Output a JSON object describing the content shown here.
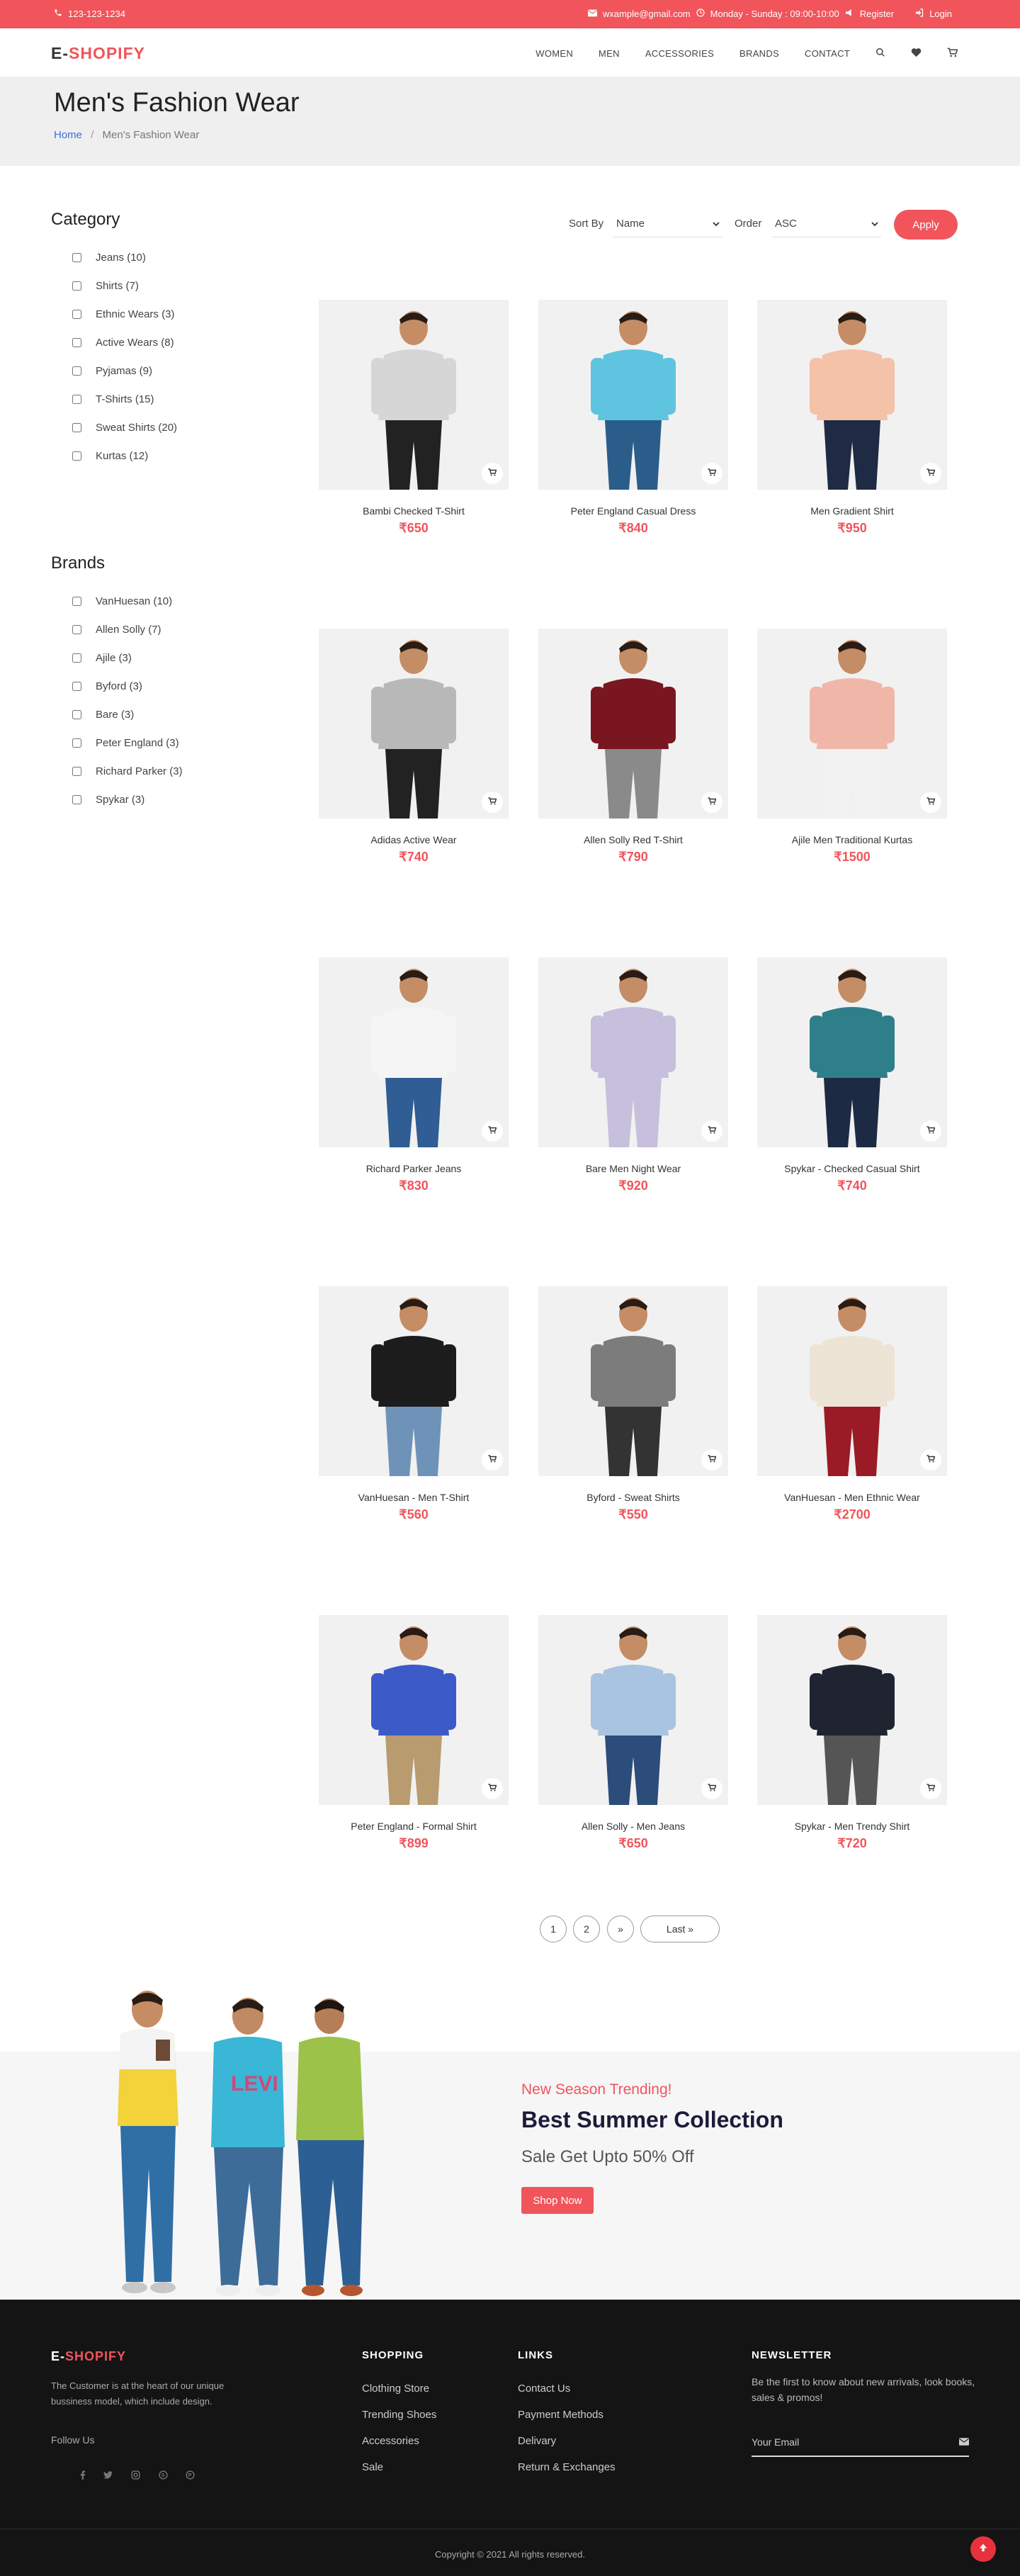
{
  "topbar": {
    "phone": "123-123-1234",
    "email": "wxample@gmail.com",
    "hours": "Monday - Sunday : 09:00-10:00",
    "register": "Register",
    "login": "Login",
    "bg_color": "#f1545b"
  },
  "header": {
    "logo_prefix": "E-",
    "logo_main": "SHOPIFY",
    "nav": [
      "WOMEN",
      "MEN",
      "ACCESSORIES",
      "BRANDS",
      "CONTACT"
    ],
    "icons": [
      "search-icon",
      "heart-icon",
      "cart-icon"
    ]
  },
  "page": {
    "title": "Men's Fashion Wear",
    "breadcrumb_home": "Home",
    "breadcrumb_sep": "/",
    "breadcrumb_current": "Men's Fashion Wear"
  },
  "sidebar": {
    "category_title": "Category",
    "categories": [
      "Jeans (10)",
      "Shirts (7)",
      "Ethnic Wears (3)",
      "Active Wears (8)",
      "Pyjamas (9)",
      "T-Shirts (15)",
      "Sweat Shirts (20)",
      "Kurtas (12)"
    ],
    "brands_title": "Brands",
    "brands": [
      "VanHuesan (10)",
      "Allen Solly (7)",
      "Ajile (3)",
      "Byford (3)",
      "Bare (3)",
      "Peter England (3)",
      "Richard Parker (3)",
      "Spykar (3)"
    ]
  },
  "sort": {
    "sort_label": "Sort By",
    "sort_value": "Name",
    "order_label": "Order",
    "order_value": "ASC",
    "apply": "Apply"
  },
  "products": [
    {
      "name": "Bambi Checked T-Shirt",
      "price": "₹650",
      "shirt": "#d6d6d6",
      "pants": "#222"
    },
    {
      "name": "Peter England Casual Dress",
      "price": "₹840",
      "shirt": "#5fc4e0",
      "pants": "#2b5d8a"
    },
    {
      "name": "Men Gradient Shirt",
      "price": "₹950",
      "shirt": "#f3c2a8",
      "pants": "#1f2a44"
    },
    {
      "name": "Adidas Active Wear",
      "price": "₹740",
      "shirt": "#b8b8b8",
      "pants": "#222"
    },
    {
      "name": "Allen Solly Red T-Shirt",
      "price": "₹790",
      "shirt": "#7a1620",
      "pants": "#8a8a8a"
    },
    {
      "name": "Ajile Men Traditional Kurtas",
      "price": "₹1500",
      "shirt": "#f0b7a8",
      "pants": "#f2f2f2"
    },
    {
      "name": "Richard Parker Jeans",
      "price": "₹830",
      "shirt": "#f5f5f5",
      "pants": "#2f5d94"
    },
    {
      "name": "Bare Men Night Wear",
      "price": "₹920",
      "shirt": "#c6c0dc",
      "pants": "#c6c0dc"
    },
    {
      "name": "Spykar - Checked Casual Shirt",
      "price": "₹740",
      "shirt": "#2f7f8a",
      "pants": "#1d2a44"
    },
    {
      "name": "VanHuesan - Men T-Shirt",
      "price": "₹560",
      "shirt": "#1c1c1c",
      "pants": "#6f93b8"
    },
    {
      "name": "Byford - Sweat Shirts",
      "price": "₹550",
      "shirt": "#7c7c7c",
      "pants": "#333"
    },
    {
      "name": "VanHuesan - Men Ethnic Wear",
      "price": "₹2700",
      "shirt": "#ede4d6",
      "pants": "#9a1b25"
    },
    {
      "name": "Peter England - Formal Shirt",
      "price": "₹899",
      "shirt": "#3c5bc8",
      "pants": "#b89b6e"
    },
    {
      "name": "Allen Solly - Men Jeans",
      "price": "₹650",
      "shirt": "#a9c4e0",
      "pants": "#2c4c7a"
    },
    {
      "name": "Spykar - Men Trendy Shirt",
      "price": "₹720",
      "shirt": "#1f2430",
      "pants": "#555"
    }
  ],
  "pagination": [
    "1",
    "2",
    "»",
    "Last »"
  ],
  "banner": {
    "subtitle": "New Season Trending!",
    "title": "Best Summer Collection",
    "text": "Sale Get Upto 50% Off",
    "button": "Shop Now"
  },
  "footer": {
    "logo_prefix": "E-",
    "logo_main": "SHOPIFY",
    "description": "The Customer is at the heart of our unique bussiness model, which include design.",
    "follow": "Follow Us",
    "social_icons": [
      "facebook-icon",
      "twitter-icon",
      "instagram-icon",
      "skype-icon",
      "pinterest-icon"
    ],
    "shopping_title": "SHOPPING",
    "shopping": [
      "Clothing Store",
      "Trending Shoes",
      "Accessories",
      "Sale"
    ],
    "links_title": "LINKS",
    "links": [
      "Contact Us",
      "Payment Methods",
      "Delivary",
      "Return & Exchanges"
    ],
    "newsletter_title": "NEWSLETTER",
    "newsletter_text": "Be the first to know about new arrivals, look books, sales & promos!",
    "email_placeholder": "Your Email",
    "copyright": "Copyright © 2021 All rights reserved."
  }
}
